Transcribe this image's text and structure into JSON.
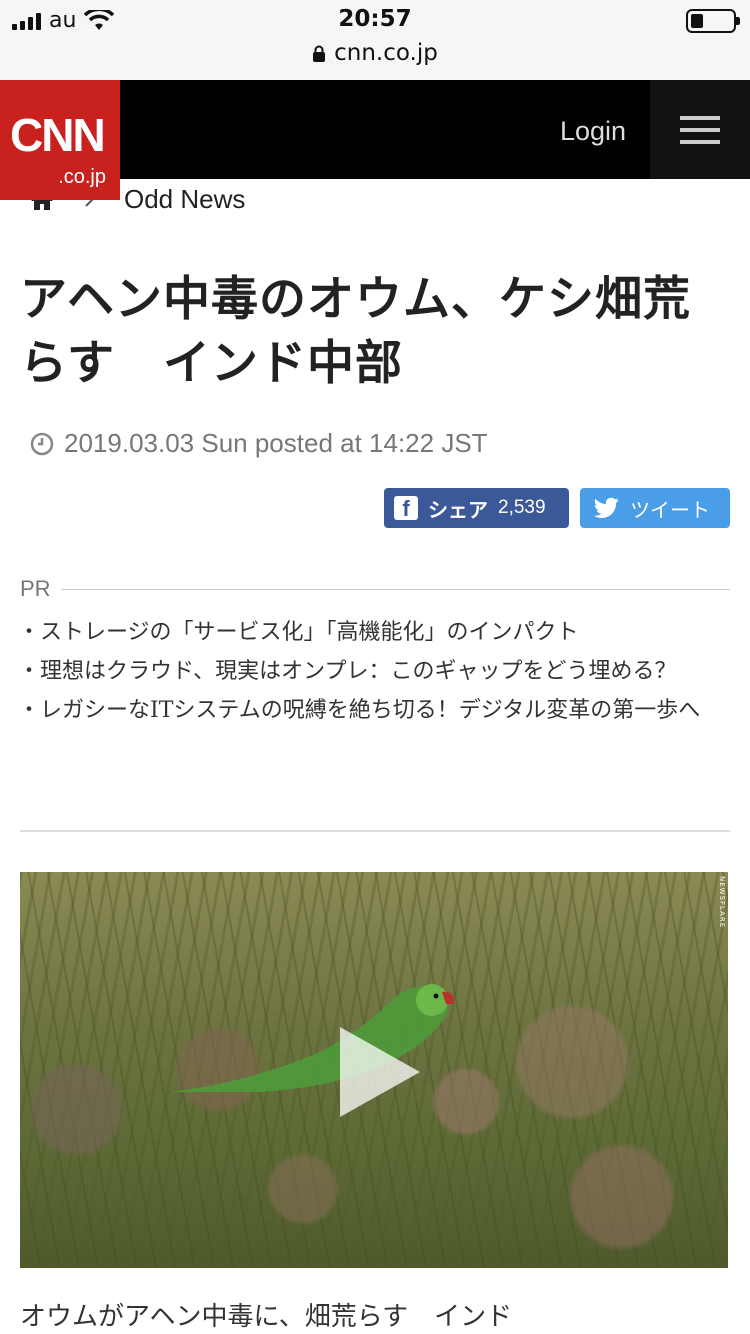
{
  "status_bar": {
    "carrier": "au",
    "time": "20:57",
    "url": "cnn.co.jp"
  },
  "header": {
    "logo_text": "CNN",
    "logo_sub": ".co.jp",
    "login_label": "Login"
  },
  "breadcrumb": {
    "section": "Odd News"
  },
  "article": {
    "title_line1": "アヘン中毒のオウム、ケシ畑荒",
    "title_line2": "らす　インド中部",
    "date": "2019.03.03 Sun posted at 14:22 JST"
  },
  "social": {
    "share_label": "シェア",
    "share_count": "2,539",
    "tweet_label": "ツイート",
    "colors": {
      "facebook": "#3b5998",
      "twitter": "#4a9ee8"
    }
  },
  "pr": {
    "heading": "PR",
    "items": [
      "ストレージの「サービス化」「高機能化」のインパクト",
      "理想はクラウド、現実はオンプレ：このギャップをどう埋める？",
      "レガシーなITシステムの呪縛を絶ち切る！デジタル変革の第一歩へ"
    ]
  },
  "video": {
    "watermark": "NEWSFLARE",
    "caption": "オウムがアヘン中毒に、畑荒らす　インド"
  },
  "brand_colors": {
    "cnn_red": "#c9211e",
    "header_bg": "#000000"
  }
}
